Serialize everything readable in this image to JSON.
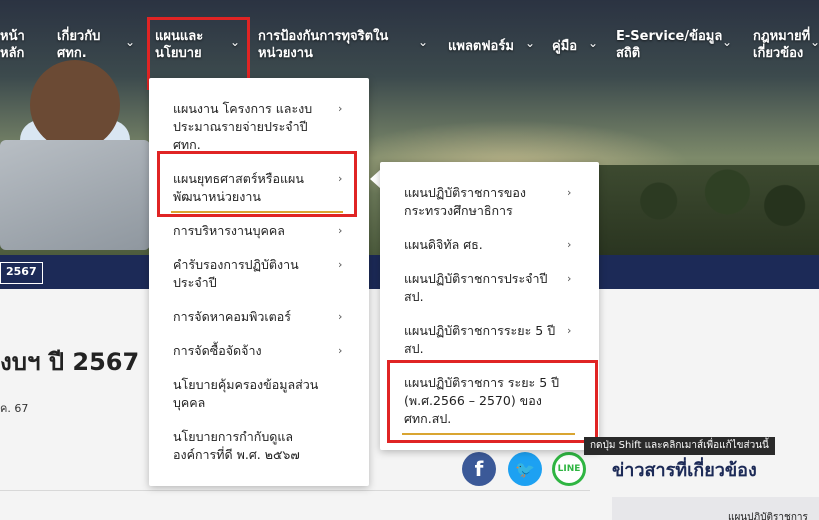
{
  "nav": {
    "items": [
      {
        "name": "home",
        "line1": "หน้า",
        "line2": "หลัก"
      },
      {
        "name": "about",
        "line1": "เกี่ยวกับ",
        "line2": "ศทก."
      },
      {
        "name": "plans-policy",
        "line1": "แผนและ",
        "line2": "นโยบาย"
      },
      {
        "name": "anti-corruption",
        "line1": "การป้องกันการทุจริตใน",
        "line2": "หน่วยงาน"
      },
      {
        "name": "platform",
        "line1": "แพลตฟอร์ม",
        "line2": ""
      },
      {
        "name": "manual",
        "line1": "คู่มือ",
        "line2": ""
      },
      {
        "name": "e-service",
        "line1": "E-Service/ข้อมูล",
        "line2": "สถิติ"
      },
      {
        "name": "law",
        "line1": "กฎหมายที่",
        "line2": "เกี่ยวข้อง"
      }
    ],
    "chevron": "⌄"
  },
  "submenu": {
    "items": [
      {
        "label": "แผนงาน โครงการ และงบ ประมาณรายจ่ายประจำปี ศทก.",
        "has_children": true
      },
      {
        "label": "แผนยุทธศาสตร์หรือแผน พัฒนาหน่วยงาน",
        "has_children": true
      },
      {
        "label": "การบริหารงานบุคคล",
        "has_children": true
      },
      {
        "label": "คำรับรองการปฏิบัติงาน ประจำปี",
        "has_children": true
      },
      {
        "label": "การจัดหาคอมพิวเตอร์",
        "has_children": true
      },
      {
        "label": "การจัดซื้อจัดจ้าง",
        "has_children": true
      },
      {
        "label": "นโยบายคุ้มครองข้อมูลส่วน บุคคล",
        "has_children": false
      },
      {
        "label": "นโยบายการกำกับดูแล องค์การที่ดี พ.ศ. ๒๕๖๗",
        "has_children": false
      }
    ],
    "chevron": "›"
  },
  "subsubmenu": {
    "items": [
      {
        "label": "แผนปฏิบัติราชการของ กระทรวงศึกษาธิการ",
        "has_children": true
      },
      {
        "label": "แผนดิจิทัล ศธ.",
        "has_children": true
      },
      {
        "label": "แผนปฏิบัติราชการประจำปี สป.",
        "has_children": true
      },
      {
        "label": "แผนปฏิบัติราชการระยะ 5 ปี สป.",
        "has_children": true
      },
      {
        "label": "แผนปฏิบัติราชการ ระยะ 5 ปี (พ.ศ.2566 – 2570) ของ ศทก.สป.",
        "has_children": false
      }
    ],
    "chevron": "›"
  },
  "breadcrumb": {
    "label": "2567"
  },
  "page": {
    "title": "งบฯ ปี 2567",
    "date": "ค. 67"
  },
  "share": {
    "facebook": "f",
    "twitter": "🐦",
    "line": "LINE"
  },
  "related": {
    "title": "ข่าวสารที่เกี่ยวข้อง",
    "card_text": "แผนปฏิบัติราชการ"
  },
  "tooltip": "กดปุ่ม Shift และคลิกเมาส์เพื่อแก้ไขส่วนนี้",
  "colors": {
    "highlight": "#e02424",
    "underline": "#d9a531",
    "band": "#1c2a57"
  }
}
